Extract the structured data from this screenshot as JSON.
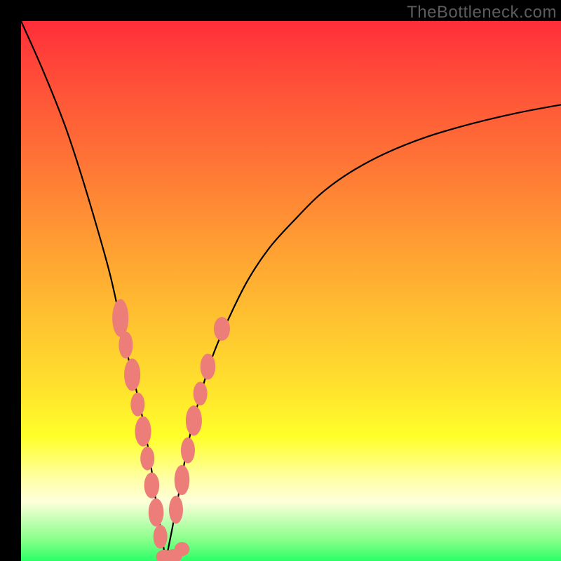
{
  "source_label": "TheBottleneck.com",
  "colors": {
    "gradient_top": "#ff2d3a",
    "gradient_bottom": "#2aff66",
    "curve": "#000000",
    "marker": "#ed7d79",
    "frame": "#000000"
  },
  "chart_data": {
    "type": "line",
    "title": "",
    "xlabel": "",
    "ylabel": "",
    "xlim": [
      0,
      100
    ],
    "ylim": [
      0,
      100
    ],
    "grid": false,
    "series": [
      {
        "name": "left-curve",
        "x": [
          0,
          4,
          8,
          11,
          14,
          16.5,
          18.5,
          20,
          21.5,
          22.8,
          24.0,
          25.0,
          26.0,
          26.8
        ],
        "values": [
          100,
          91,
          81,
          72,
          62,
          53,
          44,
          37,
          31,
          25,
          18,
          11,
          5,
          0
        ]
      },
      {
        "name": "right-curve",
        "x": [
          26.8,
          28.0,
          29.5,
          31.0,
          33.0,
          35.5,
          38.5,
          42.0,
          46.0,
          50.5,
          55.5,
          61.0,
          67.5,
          75.0,
          83.5,
          92.0,
          100.0
        ],
        "values": [
          0,
          6,
          14,
          22,
          30,
          38,
          45,
          52,
          58,
          63,
          68,
          72,
          75.5,
          78.5,
          81,
          83,
          84.5
        ]
      }
    ],
    "markers": {
      "left": [
        {
          "x": 18.4,
          "y": 45.0,
          "rx": 1.5,
          "ry": 3.5
        },
        {
          "x": 19.4,
          "y": 40.0,
          "rx": 1.3,
          "ry": 2.5
        },
        {
          "x": 20.6,
          "y": 34.5,
          "rx": 1.5,
          "ry": 3.0
        },
        {
          "x": 21.6,
          "y": 29.0,
          "rx": 1.3,
          "ry": 2.2
        },
        {
          "x": 22.6,
          "y": 24.0,
          "rx": 1.5,
          "ry": 2.8
        },
        {
          "x": 23.4,
          "y": 19.0,
          "rx": 1.3,
          "ry": 2.2
        },
        {
          "x": 24.2,
          "y": 14.0,
          "rx": 1.4,
          "ry": 2.4
        },
        {
          "x": 25.0,
          "y": 9.0,
          "rx": 1.4,
          "ry": 2.6
        },
        {
          "x": 25.8,
          "y": 4.5,
          "rx": 1.3,
          "ry": 2.2
        }
      ],
      "bottom": [
        {
          "x": 26.6,
          "y": 0.8,
          "rx": 1.6,
          "ry": 1.3
        },
        {
          "x": 28.2,
          "y": 0.9,
          "rx": 1.6,
          "ry": 1.3
        },
        {
          "x": 29.8,
          "y": 2.2,
          "rx": 1.4,
          "ry": 1.3
        }
      ],
      "right": [
        {
          "x": 28.7,
          "y": 9.5,
          "rx": 1.3,
          "ry": 2.6
        },
        {
          "x": 29.8,
          "y": 15.0,
          "rx": 1.4,
          "ry": 2.8
        },
        {
          "x": 30.9,
          "y": 20.5,
          "rx": 1.3,
          "ry": 2.4
        },
        {
          "x": 32.0,
          "y": 26.0,
          "rx": 1.5,
          "ry": 2.8
        },
        {
          "x": 33.2,
          "y": 31.0,
          "rx": 1.3,
          "ry": 2.2
        },
        {
          "x": 34.6,
          "y": 36.0,
          "rx": 1.4,
          "ry": 2.4
        },
        {
          "x": 37.2,
          "y": 43.0,
          "rx": 1.5,
          "ry": 2.2
        }
      ]
    }
  }
}
